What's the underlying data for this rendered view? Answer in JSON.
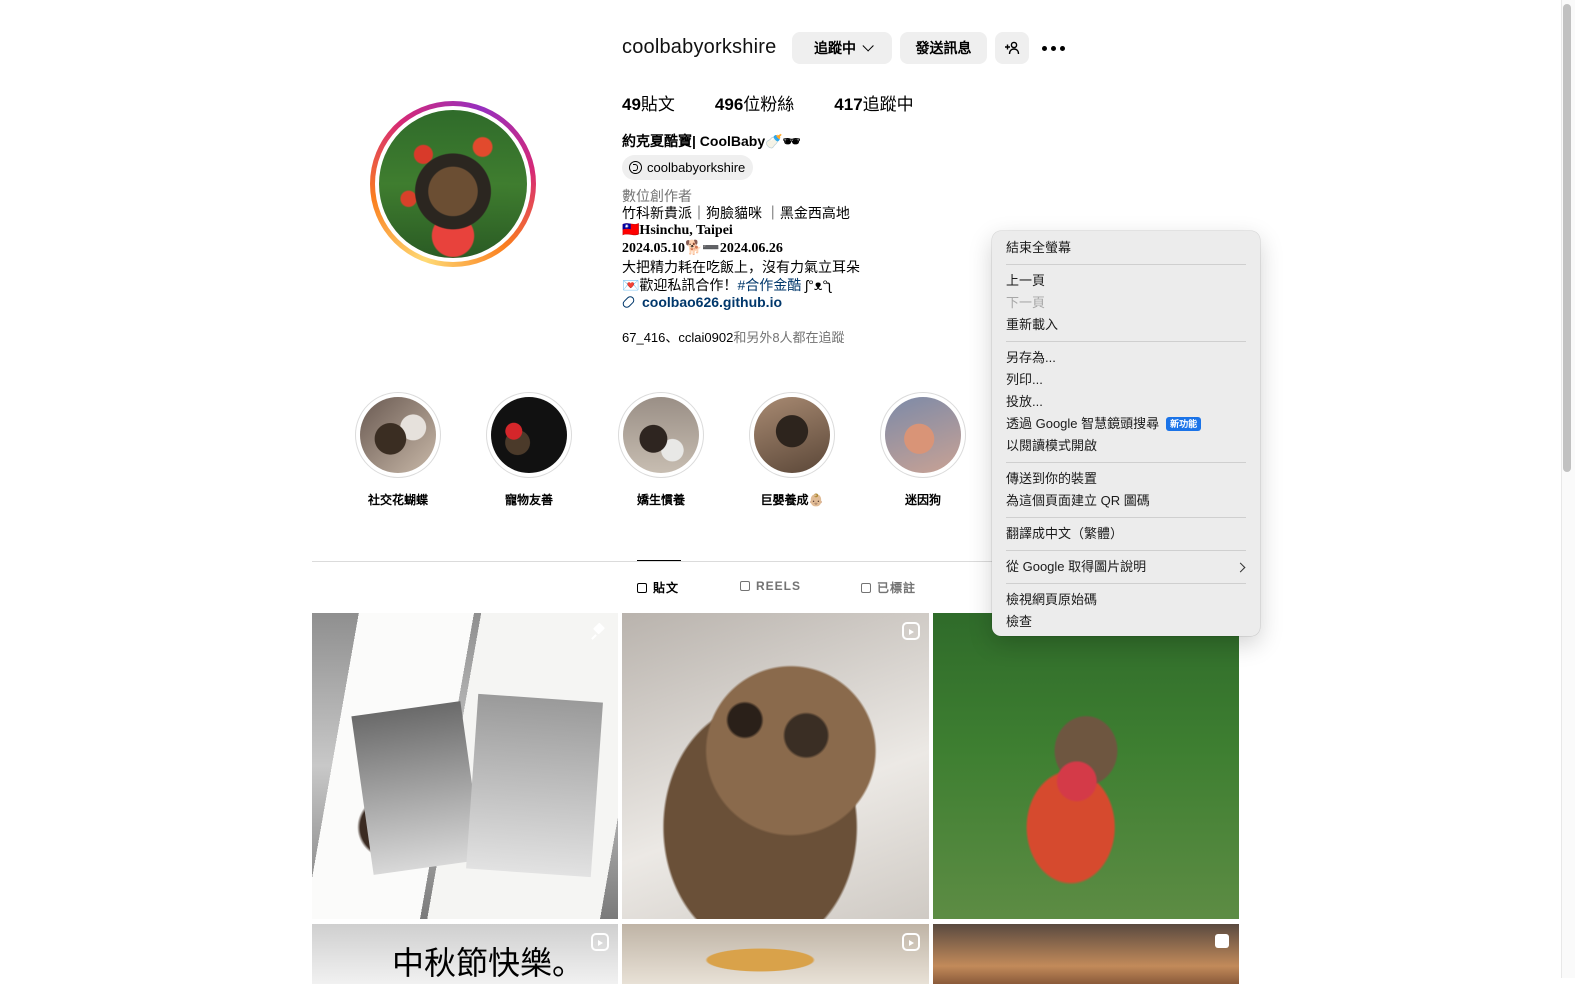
{
  "profile": {
    "username": "coolbabyorkshire",
    "following_button": "追蹤中",
    "message_button": "發送訊息",
    "stats": {
      "posts": "49",
      "posts_label": "貼文",
      "followers": "496",
      "followers_label": "位粉絲",
      "following": "417",
      "following_label": "追蹤中"
    },
    "full_name": "約克夏酷寶| CoolBaby🍼🕶",
    "threads_handle": "coolbabyorkshire",
    "category": "數位創作者",
    "bio_lines": [
      "竹科新貴派｜狗臉貓咪 ｜黑金西高地",
      "🇹🇼Hsinchu, Taipei",
      "2024.05.10🐕➖2024.06.26",
      "大把精力耗在吃飯上，沒有力氣立耳朵"
    ],
    "bio_collab_prefix": "💌歡迎私訊合作！",
    "bio_collab_hashtag": "#合作金酷",
    "bio_collab_suffix": " ʃ°ᴥ°ʅ",
    "link": "coolbao626.github.io",
    "followed_by_users": "67_416、cclai0902",
    "followed_by_suffix": "和另外8人都在追蹤"
  },
  "highlights": [
    "社交花蝴蝶",
    "寵物友善",
    "嬌生慣養",
    "巨嬰養成👶🏼",
    "迷因狗"
  ],
  "tabs": {
    "posts": "貼文",
    "reels": "REELS",
    "tagged": "已標註"
  },
  "grid": {
    "post4_text": "中秋節快樂。"
  },
  "context_menu": {
    "exit_fullscreen": "結束全螢幕",
    "back": "上一頁",
    "forward": "下一頁",
    "reload": "重新載入",
    "save_as": "另存為...",
    "print": "列印...",
    "cast": "投放...",
    "google_lens": "透過 Google 智慧鏡頭搜尋",
    "new_badge": "新功能",
    "reader_mode": "以閱讀模式開啟",
    "send_to_devices": "傳送到你的裝置",
    "qr_code": "為這個頁面建立 QR 圖碼",
    "translate": "翻譯成中文（繁體）",
    "image_descriptions": "從 Google 取得圖片說明",
    "view_source": "檢視網頁原始碼",
    "inspect": "檢查"
  },
  "colors": {
    "link": "#00376b",
    "secondary_text": "#737373",
    "badge": "#1a73e8"
  }
}
